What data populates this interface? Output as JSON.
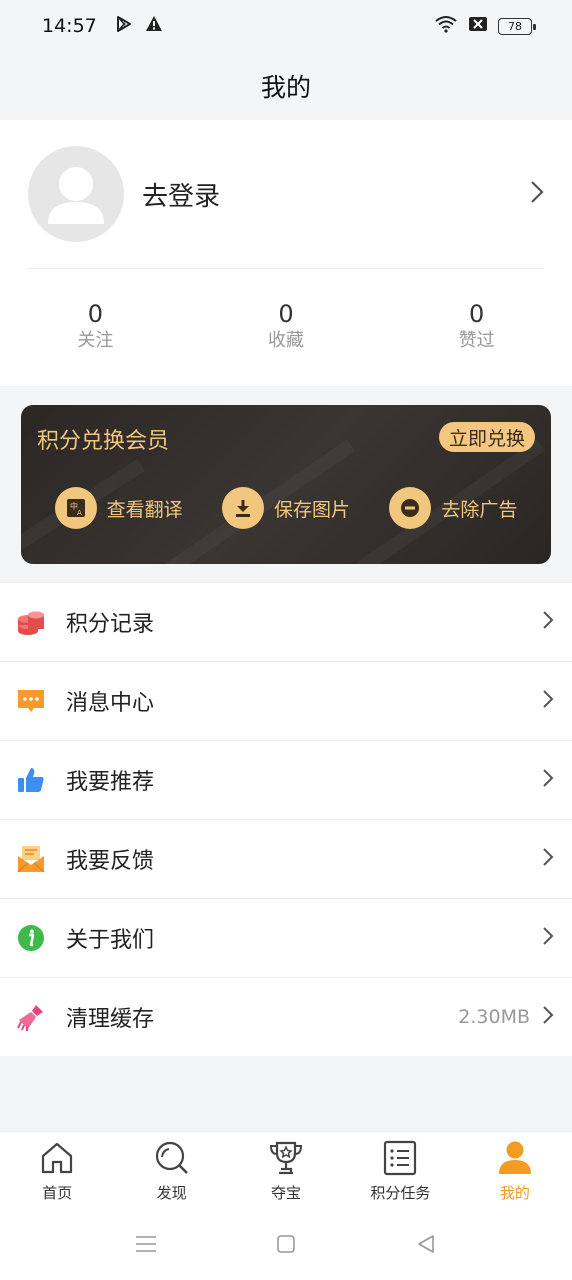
{
  "status_bar": {
    "time": "14:57",
    "battery": "78"
  },
  "header": {
    "title": "我的"
  },
  "profile": {
    "login_label": "去登录",
    "stats": [
      {
        "value": "0",
        "label": "关注"
      },
      {
        "value": "0",
        "label": "收藏"
      },
      {
        "value": "0",
        "label": "赞过"
      }
    ]
  },
  "vip": {
    "title": "积分兑换会员",
    "button": "立即兑换",
    "features": [
      {
        "icon": "translate-icon",
        "label": "查看翻译"
      },
      {
        "icon": "download-icon",
        "label": "保存图片"
      },
      {
        "icon": "remove-ad-icon",
        "label": "去除广告"
      }
    ],
    "accent_color": "#f1c77d"
  },
  "menu": [
    {
      "icon": "coins-icon",
      "label": "积分记录",
      "value": ""
    },
    {
      "icon": "message-icon",
      "label": "消息中心",
      "value": ""
    },
    {
      "icon": "thumbs-up-icon",
      "label": "我要推荐",
      "value": ""
    },
    {
      "icon": "feedback-mail-icon",
      "label": "我要反馈",
      "value": ""
    },
    {
      "icon": "info-icon",
      "label": "关于我们",
      "value": ""
    },
    {
      "icon": "broom-icon",
      "label": "清理缓存",
      "value": "2.30MB"
    }
  ],
  "tabs": [
    {
      "icon": "home-icon",
      "label": "首页",
      "active": false
    },
    {
      "icon": "discover-icon",
      "label": "发现",
      "active": false
    },
    {
      "icon": "trophy-icon",
      "label": "夺宝",
      "active": false
    },
    {
      "icon": "task-list-icon",
      "label": "积分任务",
      "active": false
    },
    {
      "icon": "user-icon",
      "label": "我的",
      "active": true
    }
  ],
  "colors": {
    "active_tab": "#f39c24",
    "vip_gold": "#f1c77d"
  }
}
